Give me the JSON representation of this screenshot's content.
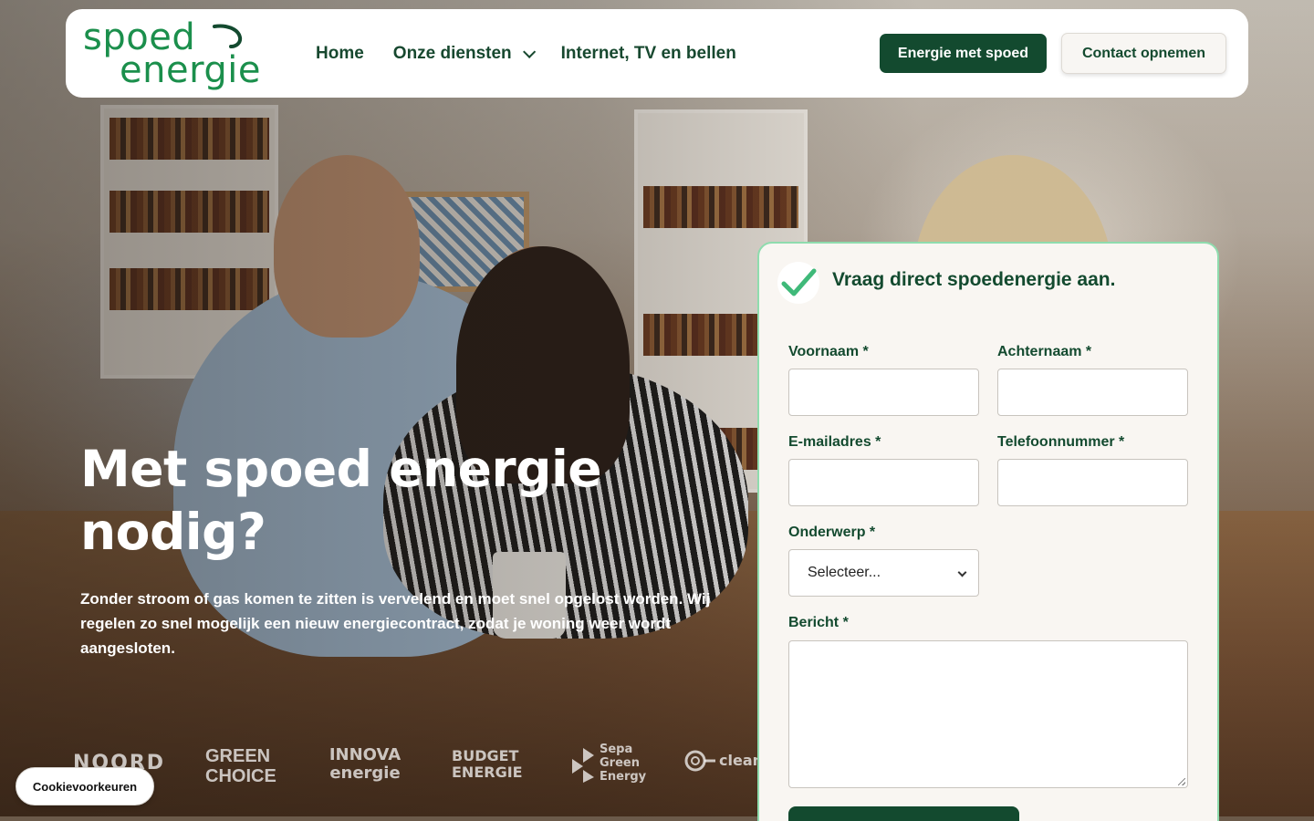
{
  "header": {
    "logo_line1": "spoed",
    "logo_line2": "energie",
    "nav": [
      {
        "label": "Home"
      },
      {
        "label": "Onze diensten",
        "has_dropdown": true
      },
      {
        "label": "Internet, TV en bellen"
      }
    ],
    "primary_button": "Energie met spoed",
    "secondary_button": "Contact opnemen"
  },
  "hero": {
    "title": "Met spoed energie nodig?",
    "text": "Zonder stroom of gas komen te zitten is vervelend en moet snel opgelost worden. Wij regelen zo snel mogelijk een nieuw energiecontract, zodat je woning weer wordt aangesloten."
  },
  "partners": [
    {
      "name": "NOORD",
      "icon": "noord-logo"
    },
    {
      "name": "GREEN CHOICE",
      "icon": "greenchoice-logo"
    },
    {
      "name": "INNOVA energie",
      "icon": "innova-logo"
    },
    {
      "name": "BUDGET ENERGIE",
      "icon": "budget-energie-logo"
    },
    {
      "name": "Sepa Green Energy",
      "icon": "sepa-logo"
    },
    {
      "name": "cleanener",
      "icon": "cleanenergy-logo"
    }
  ],
  "cookie": {
    "label": "Cookievoorkeuren"
  },
  "form": {
    "title": "Vraag direct spoedenergie aan.",
    "icon": "check-icon",
    "fields": {
      "first_name": {
        "label": "Voornaam *",
        "value": ""
      },
      "last_name": {
        "label": "Achternaam *",
        "value": ""
      },
      "email": {
        "label": "E-mailadres *",
        "value": ""
      },
      "phone": {
        "label": "Telefoonnummer *",
        "value": ""
      },
      "subject": {
        "label": "Onderwerp *",
        "selected": "Selecteer..."
      },
      "message": {
        "label": "Bericht *",
        "value": ""
      }
    }
  },
  "colors": {
    "brand_green": "#1b8f4c",
    "dark_green": "#134a2f",
    "card_border": "#8fdcae",
    "card_bg": "#f9f6f2"
  }
}
